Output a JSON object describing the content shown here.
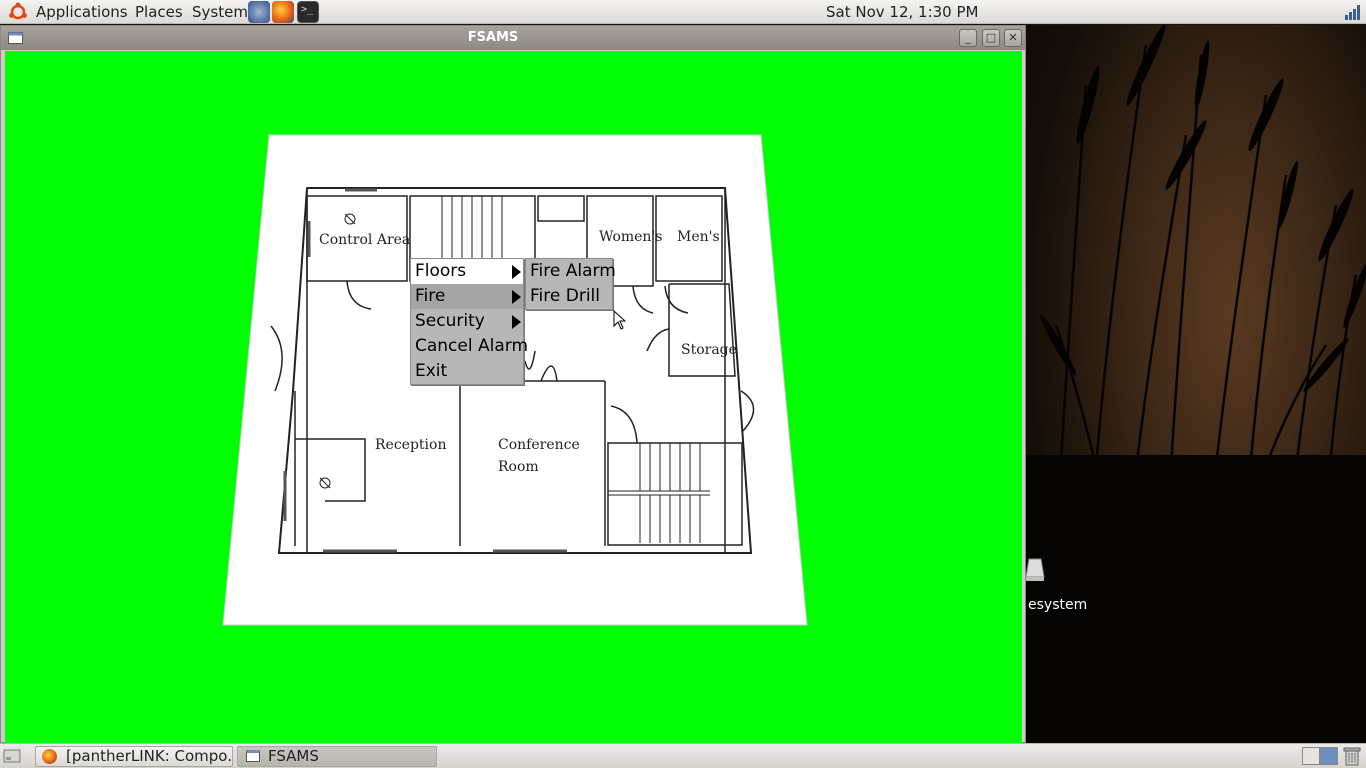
{
  "top_panel": {
    "menus": [
      "Applications",
      "Places",
      "System"
    ],
    "clock": "Sat Nov 12,  1:30 PM"
  },
  "window": {
    "title": "FSAMS"
  },
  "floor_plan": {
    "rooms": {
      "control_area": "Control Area",
      "womens": "Women's",
      "mens": "Men's",
      "storage": "Storage",
      "reception": "Reception",
      "conference_1": "Conference",
      "conference_2": "Room"
    }
  },
  "context_menu": {
    "items": [
      "Floors",
      "Fire",
      "Security",
      "Cancel Alarm",
      "Exit"
    ]
  },
  "submenu": {
    "items": [
      "Fire Alarm",
      "Fire Drill"
    ]
  },
  "desktop": {
    "icon_label": "esystem"
  },
  "taskbar": {
    "tasks": [
      "[pantherLINK: Compo...",
      "FSAMS"
    ]
  }
}
